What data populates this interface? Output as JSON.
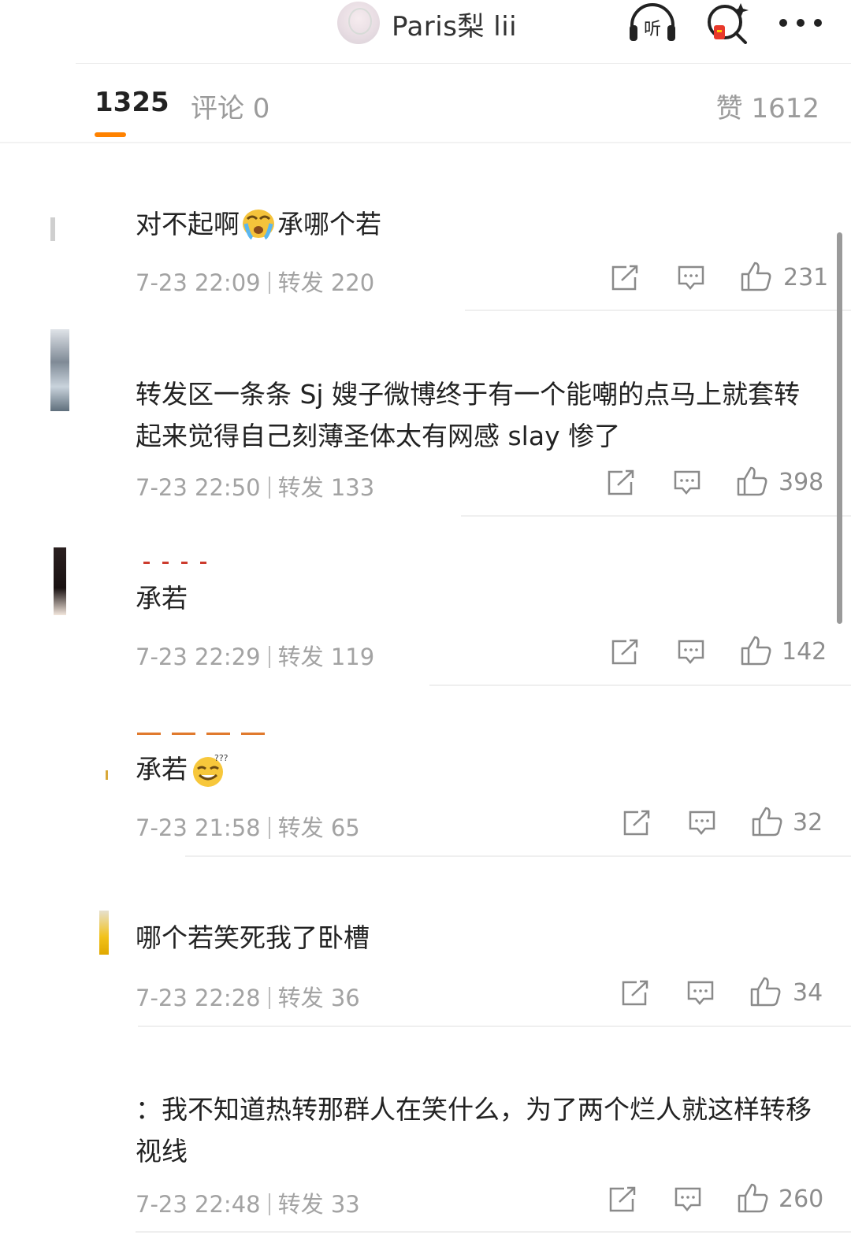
{
  "header": {
    "title": "Paris梨 lii",
    "listen_icon_label": "听",
    "icons": [
      "headphones-listen-icon",
      "search-sparkle-icon",
      "more-icon"
    ]
  },
  "tabs": {
    "reposts": "1325",
    "comments": "评论 0",
    "likes": "赞 1612",
    "accent": "#ff8200"
  },
  "reposts": [
    {
      "text": "对不起啊",
      "emoji": "crying-face-emoji",
      "text_after": "承哪个若",
      "time": "7-23 22:09",
      "repost_label": "转发 220",
      "likes": "231"
    },
    {
      "text": "转发区一条条 Sj 嫂子微博终于有一个能嘲的点马上就套转起来觉得自己刻薄圣体太有网感 slay 惨了",
      "time": "7-23 22:50",
      "repost_label": "转发 133",
      "likes": "398"
    },
    {
      "text": "承若",
      "time": "7-23 22:29",
      "repost_label": "转发 119",
      "likes": "142"
    },
    {
      "text": "承若",
      "emoji": "dizzy-grin-emoji",
      "time": "7-23 21:58",
      "repost_label": "转发 65",
      "likes": "32"
    },
    {
      "text": "哪个若笑死我了卧槽",
      "time": "7-23 22:28",
      "repost_label": "转发 36",
      "likes": "34"
    },
    {
      "text": "：我不知道热转那群人在笑什么，为了两个烂人就这样转移视线",
      "time": "7-23 22:48",
      "repost_label": "转发 33",
      "likes": "260"
    }
  ]
}
